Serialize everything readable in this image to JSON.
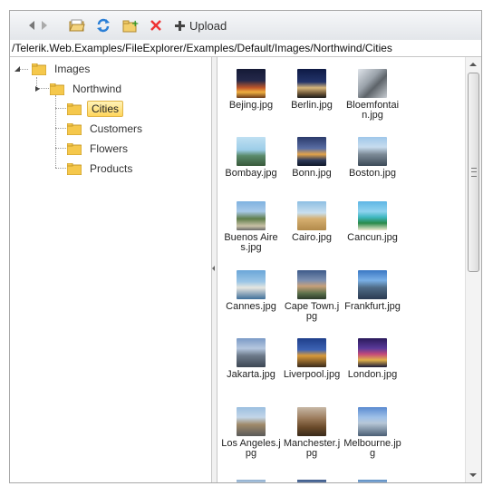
{
  "toolbar": {
    "upload_label": "Upload"
  },
  "address_path": "/Telerik.Web.Examples/FileExplorer/Examples/Default/Images/Northwind/Cities",
  "tree": {
    "root": "Images",
    "child": "Northwind",
    "folders": [
      "Cities",
      "Customers",
      "Flowers",
      "Products"
    ],
    "selected": "Cities"
  },
  "files": [
    {
      "name": "Bejing.jpg"
    },
    {
      "name": "Berlin.jpg"
    },
    {
      "name": "Bloemfontain.jpg"
    },
    {
      "name": "Bombay.jpg"
    },
    {
      "name": "Bonn.jpg"
    },
    {
      "name": "Boston.jpg"
    },
    {
      "name": "Buenos Aires.jpg"
    },
    {
      "name": "Cairo.jpg"
    },
    {
      "name": "Cancun.jpg"
    },
    {
      "name": "Cannes.jpg"
    },
    {
      "name": "Cape Town.jpg"
    },
    {
      "name": "Frankfurt.jpg"
    },
    {
      "name": "Jakarta.jpg"
    },
    {
      "name": "Liverpool.jpg"
    },
    {
      "name": "London.jpg"
    },
    {
      "name": "Los Angeles.jpg"
    },
    {
      "name": "Manchester.jpg"
    },
    {
      "name": "Melbourne.jpg"
    }
  ],
  "colors": {
    "selection_bg": "#ffd65c",
    "folder": "#f5c84c"
  }
}
